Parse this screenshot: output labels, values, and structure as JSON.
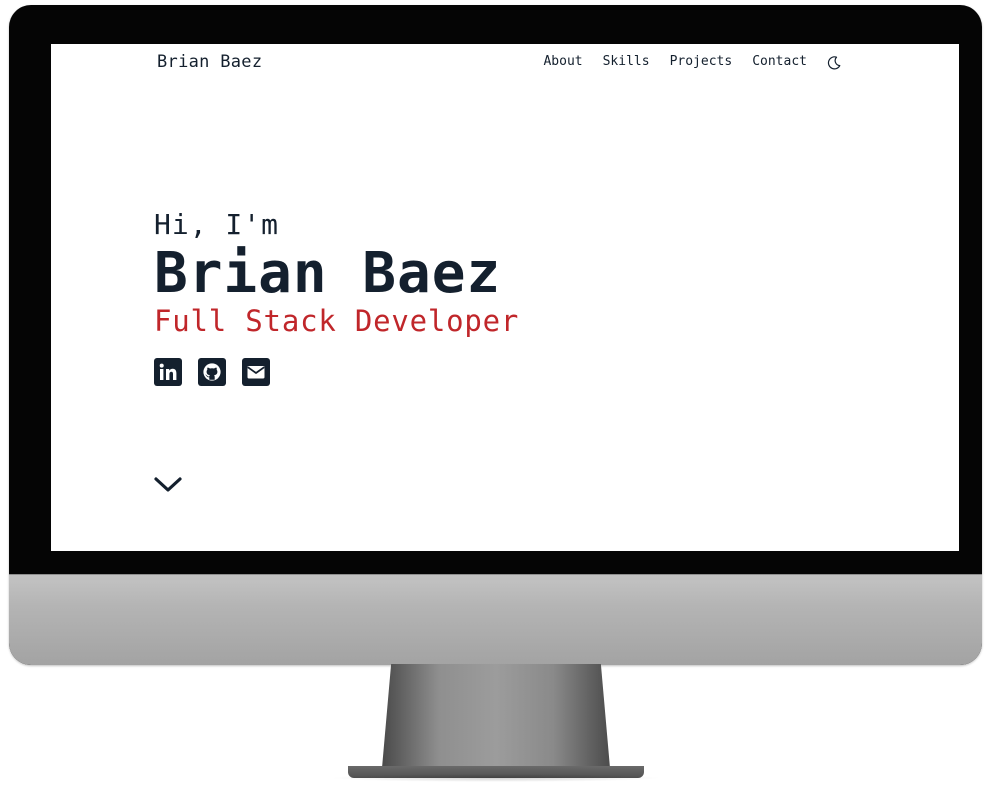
{
  "nav": {
    "brand": "Brian Baez",
    "links": [
      "About",
      "Skills",
      "Projects",
      "Contact"
    ],
    "theme_toggle_icon": "moon-icon"
  },
  "hero": {
    "greeting": "Hi, I'm",
    "name": "Brian Baez",
    "role": "Full Stack Developer",
    "socials": [
      {
        "icon": "linkedin-icon"
      },
      {
        "icon": "github-icon"
      },
      {
        "icon": "email-icon"
      }
    ],
    "scroll_icon": "chevron-down-icon"
  },
  "colors": {
    "text": "#14202e",
    "accent": "#c0262a",
    "background": "#ffffff"
  }
}
